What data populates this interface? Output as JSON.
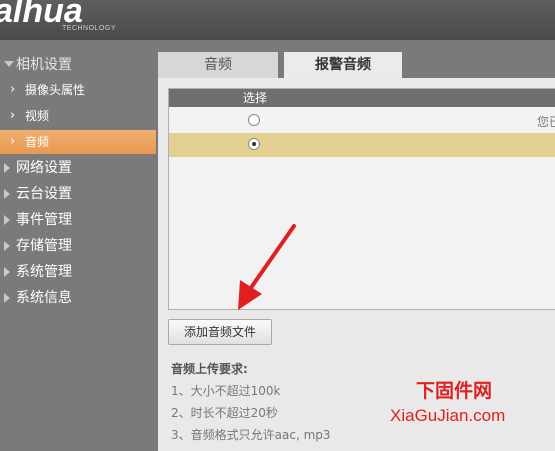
{
  "header": {
    "logo_text": "alhua",
    "logo_sub": "TECHNOLOGY"
  },
  "sidebar": {
    "categories": [
      {
        "label": "相机设置"
      },
      {
        "label": "网络设置"
      },
      {
        "label": "云台设置"
      },
      {
        "label": "事件管理"
      },
      {
        "label": "存储管理"
      },
      {
        "label": "系统管理"
      },
      {
        "label": "系统信息"
      }
    ],
    "camera_items": [
      {
        "label": "摄像头属性"
      },
      {
        "label": "视频"
      },
      {
        "label": "音频",
        "active": true
      }
    ],
    "active_color": "#e89850"
  },
  "tabs": [
    {
      "label": "音频"
    },
    {
      "label": "报警音频",
      "selected": true
    }
  ],
  "table": {
    "column_header": "选择",
    "rows": [
      {
        "selected": false,
        "note": "您已"
      },
      {
        "selected": true,
        "note": ""
      }
    ],
    "selected_row_color": "#e3cf8f"
  },
  "add_button": "添加音频文件",
  "requirements": {
    "title": "音频上传要求:",
    "items": [
      "1、大小不超过100k",
      "2、时长不超过20秒",
      "3、音频格式只允许aac, mp3"
    ]
  },
  "watermark": {
    "line1": "下固件网",
    "line2": "XiaGuJian.com",
    "color": "#e02020"
  }
}
